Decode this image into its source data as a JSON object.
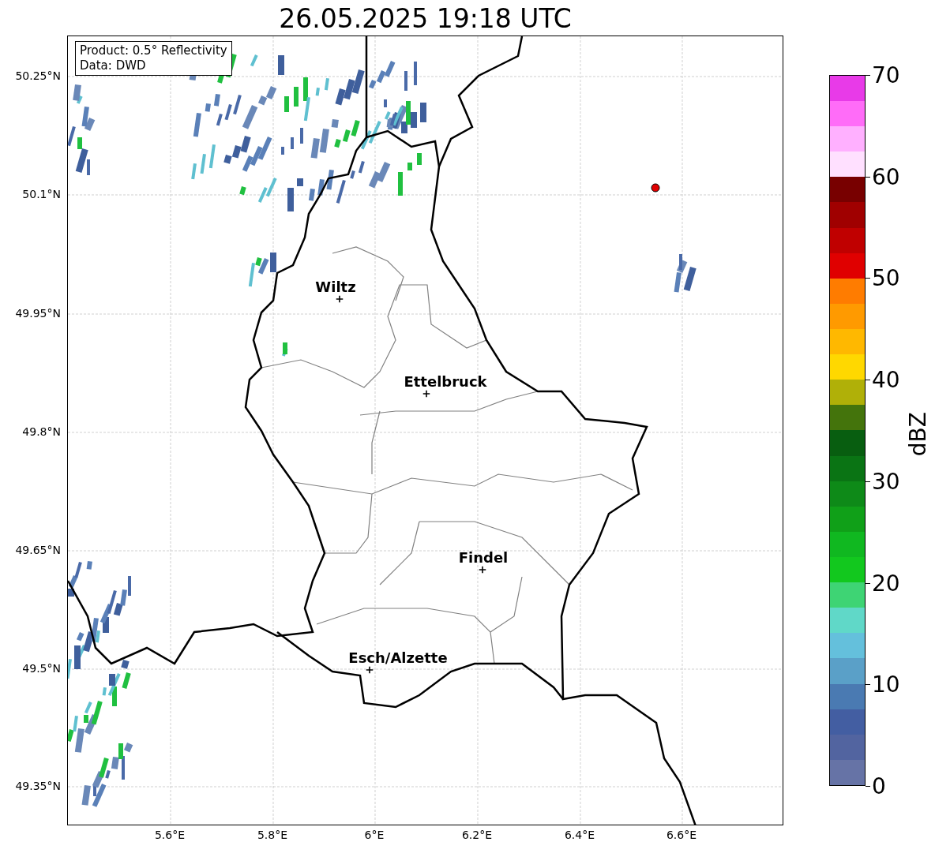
{
  "title": "26.05.2025 19:18 UTC",
  "info_box": {
    "lines": [
      "Product: 0.5° Reflectivity",
      "Data: DWD"
    ]
  },
  "y_ticks": [
    "50.25°N",
    "50.1°N",
    "49.95°N",
    "49.8°N",
    "49.65°N",
    "49.5°N",
    "49.35°N"
  ],
  "x_ticks": [
    "5.6°E",
    "5.8°E",
    "6°E",
    "6.2°E",
    "6.4°E",
    "6.6°E"
  ],
  "cities": [
    {
      "name": "Wiltz"
    },
    {
      "name": "Ettelbruck"
    },
    {
      "name": "Findel"
    },
    {
      "name": "Esch/Alzette"
    }
  ],
  "colorbar": {
    "label": "dBZ",
    "ticks": [
      "70",
      "60",
      "50",
      "40",
      "30",
      "20",
      "10",
      "0"
    ],
    "bins": [
      {
        "color": "#6673a6"
      },
      {
        "color": "#5264a0"
      },
      {
        "color": "#435ea2"
      },
      {
        "color": "#4a7ab2"
      },
      {
        "color": "#5aa0c8"
      },
      {
        "color": "#64c0dc"
      },
      {
        "color": "#60d8c8"
      },
      {
        "color": "#3ed474"
      },
      {
        "color": "#12c81e"
      },
      {
        "color": "#10b820"
      },
      {
        "color": "#10a018"
      },
      {
        "color": "#0e8a18"
      },
      {
        "color": "#0a7414"
      },
      {
        "color": "#085e10"
      },
      {
        "color": "#44740c"
      },
      {
        "color": "#b0b008"
      },
      {
        "color": "#ffd800"
      },
      {
        "color": "#ffb800"
      },
      {
        "color": "#ff9a00"
      },
      {
        "color": "#ff7c00"
      },
      {
        "color": "#e00000"
      },
      {
        "color": "#c00000"
      },
      {
        "color": "#a00000"
      },
      {
        "color": "#780000"
      },
      {
        "color": "#ffe0ff"
      },
      {
        "color": "#ffb0ff"
      },
      {
        "color": "#ff6cf8"
      },
      {
        "color": "#e83ae8"
      }
    ]
  }
}
